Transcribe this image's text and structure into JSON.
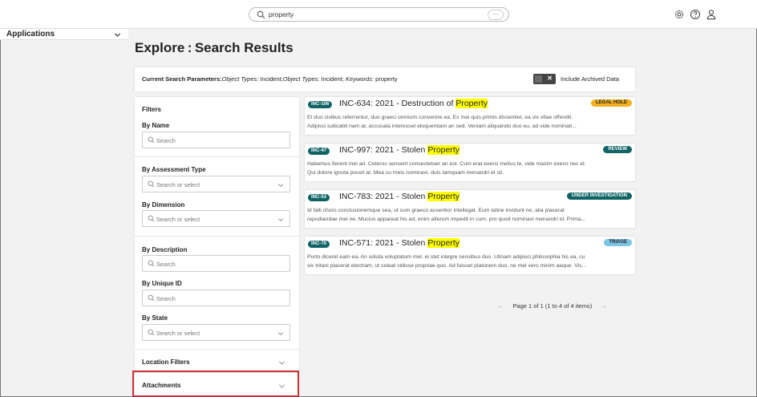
{
  "topbar": {
    "search_query": "property",
    "more_icon": "more-horizontal-icon",
    "settings_icon": "gear-icon",
    "help_icon": "help-circle-icon",
    "user_icon": "user-icon"
  },
  "apps": {
    "label": "Applications"
  },
  "page": {
    "title": "Explore : Search Results"
  },
  "params": {
    "label": "Current Search Parameters:",
    "object_types_1": "Object Types:",
    "value_1": " Incident;",
    "object_types_2": "Object Types:",
    "value_2": " Incident; ",
    "keywords_label": "Keywords:",
    "keywords_value": " property",
    "archived_label": "Include Archived Data",
    "toggle_x": "✕"
  },
  "filters": {
    "title": "Filters",
    "by_name": "By Name",
    "by_name_placeholder": "Search",
    "by_assessment": "By Assessment Type",
    "by_assessment_placeholder": "Search or select",
    "by_dimension": "By Dimension",
    "by_dimension_placeholder": "Search or select",
    "by_description": "By Description",
    "by_description_placeholder": "Search",
    "by_unique_id": "By Unique ID",
    "by_unique_id_placeholder": "Search",
    "by_state": "By State",
    "by_state_placeholder": "Search or select",
    "location": "Location Filters",
    "attachments": "Attachments"
  },
  "results": [
    {
      "id": "INC-106",
      "title_prefix": "INC-634: 2021 - Destruction of ",
      "highlight": "Property",
      "badge": "LEGAL HOLD",
      "badge_bg": "#f2b01e",
      "badge_fg": "#222222",
      "desc1": "Et duo civibus referrentur, duo graeci omnium convenire ea. Ex mei quis primis dissentiet, ea vix vitae offendit.",
      "desc2": "Adipisci iudicabit nam at, accusata interesset eloquentiam an sed. Veniam aliquando duo eu, ad vide nominati..."
    },
    {
      "id": "INC-47",
      "title_prefix": "INC-997: 2021 - Stolen ",
      "highlight": "Property",
      "badge": "REVIEW",
      "badge_bg": "#106466",
      "badge_fg": "#ffffff",
      "desc1": "Habemus fierent mel ad. Ceteros senserit consectetuer an est. Cum erat exerci melius te, vide mazim exerci nec id.",
      "desc2": "Qui dolore ignota possit at. Mea cu meis nominavi, duis tamquam menandri et sit."
    },
    {
      "id": "INC-53",
      "title_prefix": "INC-783: 2021 - Stolen ",
      "highlight": "Property",
      "badge": "UNDER INVESTIGATION",
      "badge_bg": "#106466",
      "badge_fg": "#ffffff",
      "desc1": "Id falli choro conclusionemque sea, ut cum graeco assentior intellegat. Eum latine invidunt ne, alia placerat",
      "desc2": "repudiandae mei ne. Mucius appareat his ad, enim alterum impedit in cum, pro quod nominavi menandri id. Prima..."
    },
    {
      "id": "INC-75",
      "title_prefix": "INC-571: 2021 - Stolen ",
      "highlight": "Property",
      "badge": "TRIAGE",
      "badge_bg": "#7cc4e6",
      "badge_fg": "#222222",
      "desc1": "Purto diceret eam ea. An soluta voluptatum mel, ei stet integre sensibus duo. Utinam adipisci philosophia his ea, cu",
      "desc2": "vix tritani placerat electram, ut soleat vidisse propriae quo. Ad fuisset platonem duo, ne mel vero minim aeque. Vis..."
    }
  ],
  "pager": {
    "prev": "←",
    "text": "Page 1 of 1 (1 to 4 of 4 items)",
    "next": "→"
  }
}
